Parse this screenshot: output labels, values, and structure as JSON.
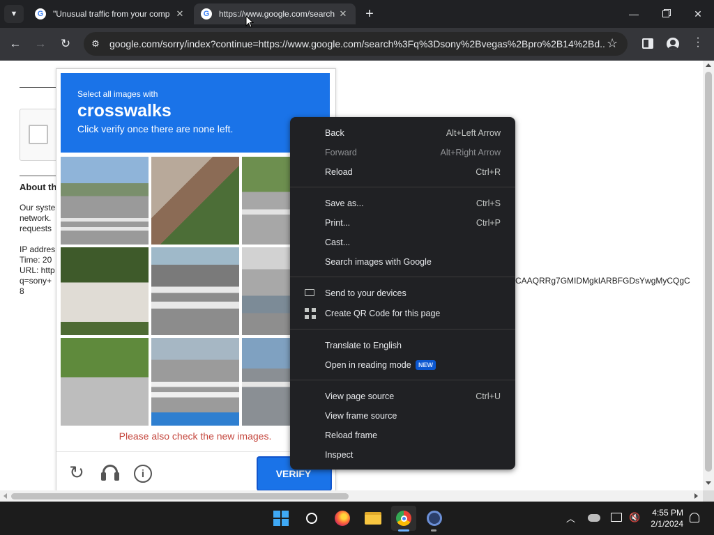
{
  "tabs": [
    {
      "title": "\"Unusual traffic from your comp",
      "active": false
    },
    {
      "title": "https://www.google.com/search",
      "active": true
    }
  ],
  "address_bar": {
    "url": "google.com/sorry/index?continue=https://www.google.com/search%3Fq%3Dsony%2Bvegas%2Bpro%2B14%2Bd..."
  },
  "page": {
    "heading_partial": "About th",
    "body_lines": [
      "Our syste",
      "network.",
      "requests"
    ],
    "ip_lines": [
      "IP addres",
      "Time: 20",
      "URL: http",
      "q=sony+",
      "8"
    ],
    "long_token": "CAAQRRg7GMIDMgkIARBFGDsYwgMyCQgC"
  },
  "captcha": {
    "instruction": "Select all images with",
    "target": "crosswalks",
    "subinstruction": "Click verify once there are none left.",
    "error_message": "Please also check the new images.",
    "verify_label": "VERIFY"
  },
  "context_menu": {
    "groups": [
      [
        {
          "label": "Back",
          "shortcut": "Alt+Left Arrow",
          "disabled": false
        },
        {
          "label": "Forward",
          "shortcut": "Alt+Right Arrow",
          "disabled": true
        },
        {
          "label": "Reload",
          "shortcut": "Ctrl+R",
          "disabled": false
        }
      ],
      [
        {
          "label": "Save as...",
          "shortcut": "Ctrl+S",
          "disabled": false
        },
        {
          "label": "Print...",
          "shortcut": "Ctrl+P",
          "disabled": false
        },
        {
          "label": "Cast...",
          "shortcut": "",
          "disabled": false
        },
        {
          "label": "Search images with Google",
          "shortcut": "",
          "disabled": false
        }
      ],
      [
        {
          "label": "Send to your devices",
          "shortcut": "",
          "disabled": false,
          "icon": "devices-icon"
        },
        {
          "label": "Create QR Code for this page",
          "shortcut": "",
          "disabled": false,
          "icon": "qr-code-icon"
        }
      ],
      [
        {
          "label": "Translate to English",
          "shortcut": "",
          "disabled": false
        },
        {
          "label": "Open in reading mode",
          "shortcut": "",
          "disabled": false,
          "badge": "NEW"
        }
      ],
      [
        {
          "label": "View page source",
          "shortcut": "Ctrl+U",
          "disabled": false
        },
        {
          "label": "View frame source",
          "shortcut": "",
          "disabled": false
        },
        {
          "label": "Reload frame",
          "shortcut": "",
          "disabled": false
        },
        {
          "label": "Inspect",
          "shortcut": "",
          "disabled": false
        }
      ]
    ]
  },
  "taskbar": {
    "time": "4:55 PM",
    "date": "2/1/2024"
  },
  "colors": {
    "banner_blue": "#1a73e8",
    "error_red": "#c5483f",
    "menu_bg": "#202124",
    "new_badge": "#0b57d0"
  }
}
